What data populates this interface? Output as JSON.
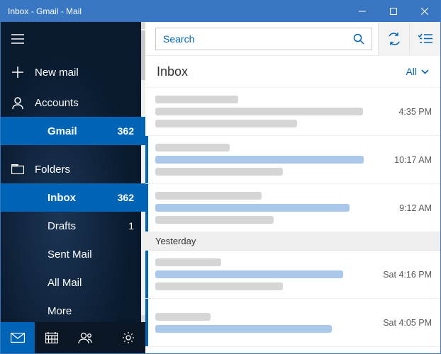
{
  "window": {
    "title": "Inbox - Gmail - Mail"
  },
  "search": {
    "placeholder": "Search"
  },
  "sidebar": {
    "new_mail": "New mail",
    "accounts_label": "Accounts",
    "account": {
      "name": "Gmail",
      "count": "362"
    },
    "folders_label": "Folders",
    "folders": [
      {
        "label": "Inbox",
        "count": "362"
      },
      {
        "label": "Drafts",
        "count": "1"
      },
      {
        "label": "Sent Mail",
        "count": ""
      },
      {
        "label": "All Mail",
        "count": ""
      },
      {
        "label": "More",
        "count": ""
      }
    ]
  },
  "list": {
    "heading": "Inbox",
    "filter": "All",
    "group_yesterday": "Yesterday",
    "messages": [
      {
        "time": "4:35 PM"
      },
      {
        "time": "10:17 AM"
      },
      {
        "time": "9:12 AM"
      },
      {
        "time": "Sat 4:16 PM"
      },
      {
        "time": "Sat 4:05 PM"
      }
    ]
  }
}
